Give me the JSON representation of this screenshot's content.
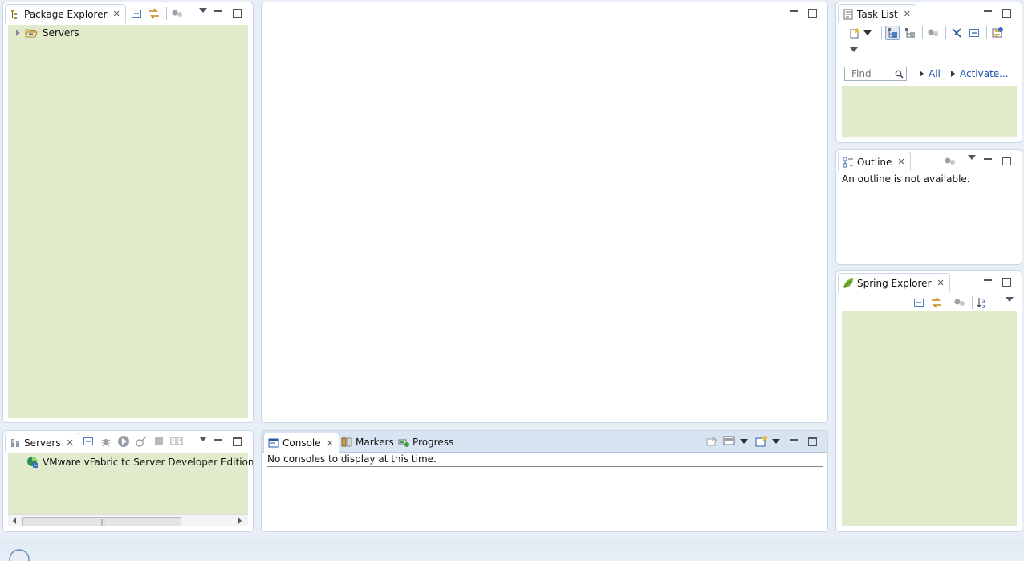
{
  "package_explorer": {
    "title": "Package Explorer",
    "tree_items": [
      {
        "label": "Servers"
      }
    ]
  },
  "task_list": {
    "title": "Task List",
    "find_placeholder": "Find",
    "filter_all": "All",
    "filter_activate": "Activate..."
  },
  "outline": {
    "title": "Outline",
    "message": "An outline is not available."
  },
  "spring_explorer": {
    "title": "Spring Explorer"
  },
  "servers": {
    "title": "Servers",
    "items": [
      {
        "label": "VMware vFabric tc Server Developer Edition"
      }
    ]
  },
  "console_stack": {
    "tabs": [
      {
        "label": "Console"
      },
      {
        "label": "Markers"
      },
      {
        "label": "Progress"
      }
    ],
    "message": "No consoles to display at this time."
  },
  "colors": {
    "background": "#e8eef6",
    "tree_bg": "#e1ebcc",
    "link": "#1a4fae",
    "panel_border": "#c9d6e6"
  }
}
